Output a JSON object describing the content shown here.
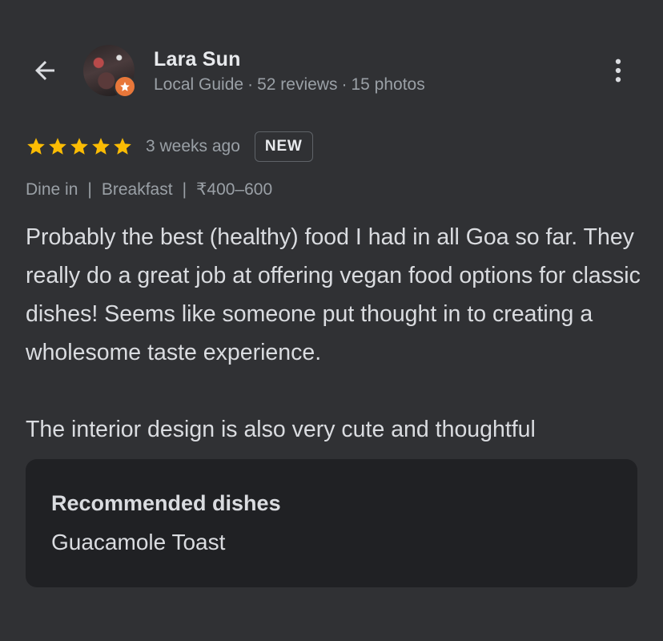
{
  "reviewer": {
    "name": "Lara Sun",
    "role": "Local Guide",
    "reviews": "52 reviews",
    "photos": "15 photos",
    "separator": "·"
  },
  "review": {
    "rating": 5,
    "time_ago": "3 weeks ago",
    "badge": "NEW",
    "tags": [
      "Dine in",
      "Breakfast",
      "₹400–600"
    ],
    "tag_separator": "|",
    "paragraph_1": "Probably the best (healthy) food I had in all Goa so far. They really do a great job at offering vegan food options for classic dishes! Seems like someone put thought in to creating a wholesome taste experience.",
    "paragraph_2": "The interior design is also very cute and thoughtful"
  },
  "recommended": {
    "title": "Recommended dishes",
    "dish": "Guacamole Toast"
  },
  "icons": {
    "back": "arrow-back-icon",
    "more": "more-vert-icon",
    "star": "star-icon",
    "guide_badge": "local-guide-star-icon"
  },
  "colors": {
    "background": "#303134",
    "card": "#202124",
    "star": "#fbbc04",
    "guide_badge": "#e8773a",
    "secondary_text": "#9aa0a6"
  }
}
